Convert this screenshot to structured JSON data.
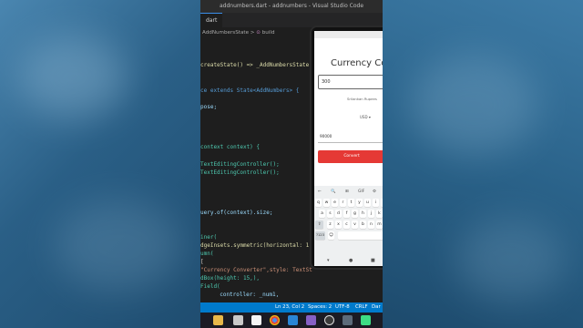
{
  "window": {
    "title": "addnumbers.dart - addnumbers - Visual Studio Code"
  },
  "editor": {
    "tab_label": "dart",
    "breadcrumb": "AddNumbersState > ",
    "breadcrumb_build": "build",
    "code_lines": [
      "createState() => _AddNumbersState(",
      "ce extends State<AddNumbers> {",
      "pose;",
      "context context) {",
      "TextEditingController();",
      "TextEditingController();",
      "uery.of(context).size;",
      "iner(",
      "dgeInsets.symmetric(horizontal: 1",
      "umn(",
      "[",
      "\"Currency Converter\",style: TextSt",
      "dBox(height: 15,),",
      "Field(",
      "  controller: _num1,"
    ]
  },
  "status_bar": {
    "position": "Ln 23, Col 2",
    "spaces": "Spaces: 2",
    "encoding": "UTF-8",
    "eol": "CRLF",
    "language": "Dar"
  },
  "taskbar": {
    "icons": [
      "folder-icon",
      "files-icon",
      "media-icon",
      "chrome-icon",
      "vscode-icon",
      "vs-icon",
      "obs-icon",
      "settings-icon",
      "android-studio-icon"
    ]
  },
  "app": {
    "title": "Currency Conver",
    "amount_value": "300",
    "from_label": "Srilankan Rupees",
    "to_currency": "USD",
    "to_arrow": "▾",
    "result_value": "90000",
    "convert_label": "Convert"
  },
  "keyboard": {
    "toolbar": [
      "←",
      "🔍",
      "⊞",
      "GIF",
      "⚙"
    ],
    "row1": [
      "q",
      "w",
      "e",
      "r",
      "t",
      "y",
      "u",
      "i",
      "o"
    ],
    "row2": [
      "a",
      "s",
      "d",
      "f",
      "g",
      "h",
      "j",
      "k",
      "l"
    ],
    "row3": [
      "⇧",
      "z",
      "x",
      "c",
      "v",
      "b",
      "n",
      "m"
    ],
    "row4_symbols": "?123",
    "row4_emoji": "☺",
    "nav": [
      "▾",
      "●",
      "■"
    ]
  },
  "colors": {
    "vscode_status": "#007acc",
    "convert_button": "#e53935",
    "editor_bg": "#1e1e1e"
  }
}
